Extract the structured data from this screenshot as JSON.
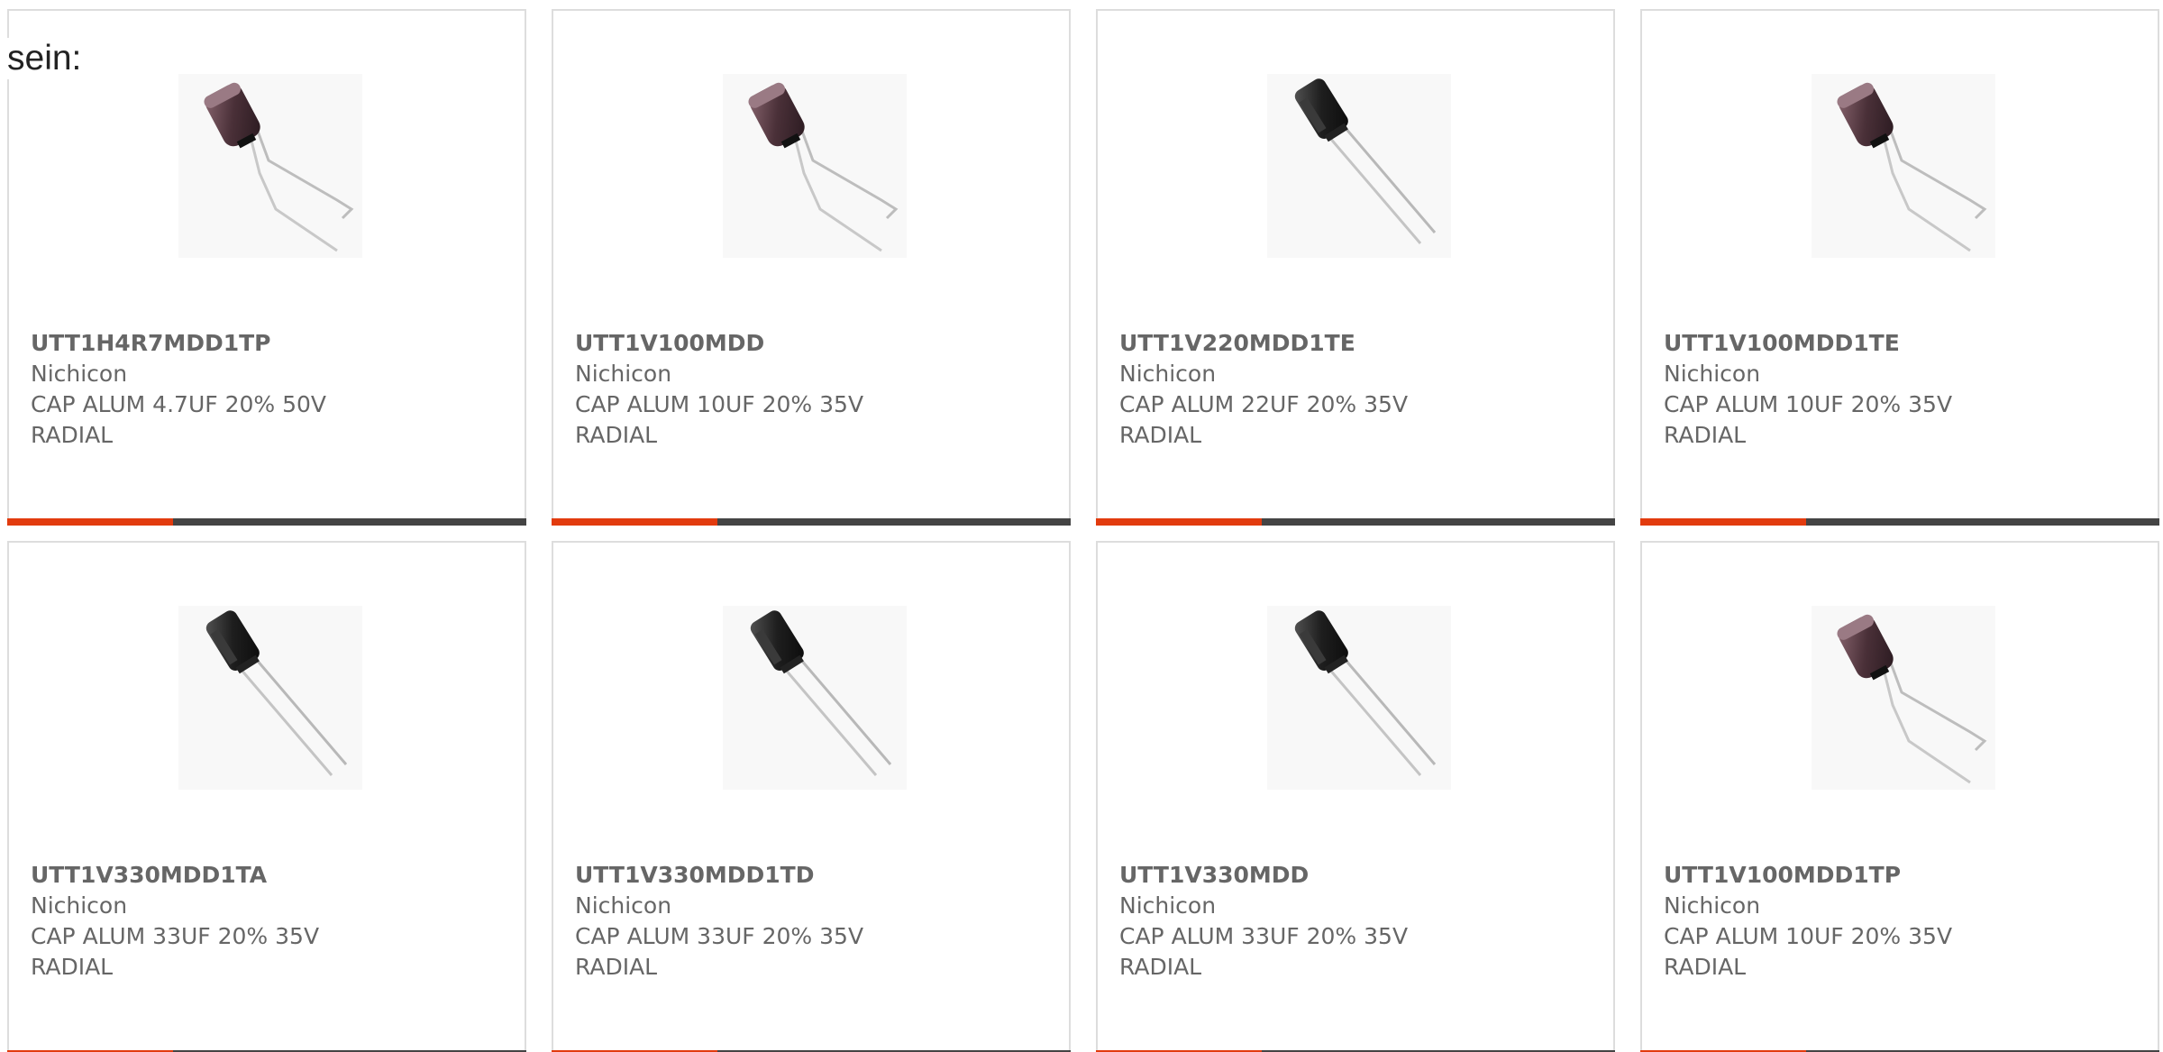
{
  "intro_text": "sein:",
  "colors": {
    "accent": "#e23b0e",
    "bar": "#444444",
    "text": "#666666",
    "border": "#dddddd"
  },
  "products": [
    {
      "part_number": "UTT1H4R7MDD1TP",
      "manufacturer": "Nichicon",
      "description": "CAP ALUM 4.7UF 20% 50V RADIAL",
      "image": "capacitor-bent-leads-brown-icon"
    },
    {
      "part_number": "UTT1V100MDD",
      "manufacturer": "Nichicon",
      "description": "CAP ALUM 10UF 20% 35V RADIAL",
      "image": "capacitor-bent-leads-brown-icon"
    },
    {
      "part_number": "UTT1V220MDD1TE",
      "manufacturer": "Nichicon",
      "description": "CAP ALUM 22UF 20% 35V RADIAL",
      "image": "capacitor-straight-leads-black-icon"
    },
    {
      "part_number": "UTT1V100MDD1TE",
      "manufacturer": "Nichicon",
      "description": "CAP ALUM 10UF 20% 35V RADIAL",
      "image": "capacitor-bent-leads-brown-icon"
    },
    {
      "part_number": "UTT1V330MDD1TA",
      "manufacturer": "Nichicon",
      "description": "CAP ALUM 33UF 20% 35V RADIAL",
      "image": "capacitor-straight-leads-black-icon"
    },
    {
      "part_number": "UTT1V330MDD1TD",
      "manufacturer": "Nichicon",
      "description": "CAP ALUM 33UF 20% 35V RADIAL",
      "image": "capacitor-straight-leads-black-icon"
    },
    {
      "part_number": "UTT1V330MDD",
      "manufacturer": "Nichicon",
      "description": "CAP ALUM 33UF 20% 35V RADIAL",
      "image": "capacitor-straight-leads-black-icon"
    },
    {
      "part_number": "UTT1V100MDD1TP",
      "manufacturer": "Nichicon",
      "description": "CAP ALUM 10UF 20% 35V RADIAL",
      "image": "capacitor-bent-leads-brown-icon"
    }
  ]
}
